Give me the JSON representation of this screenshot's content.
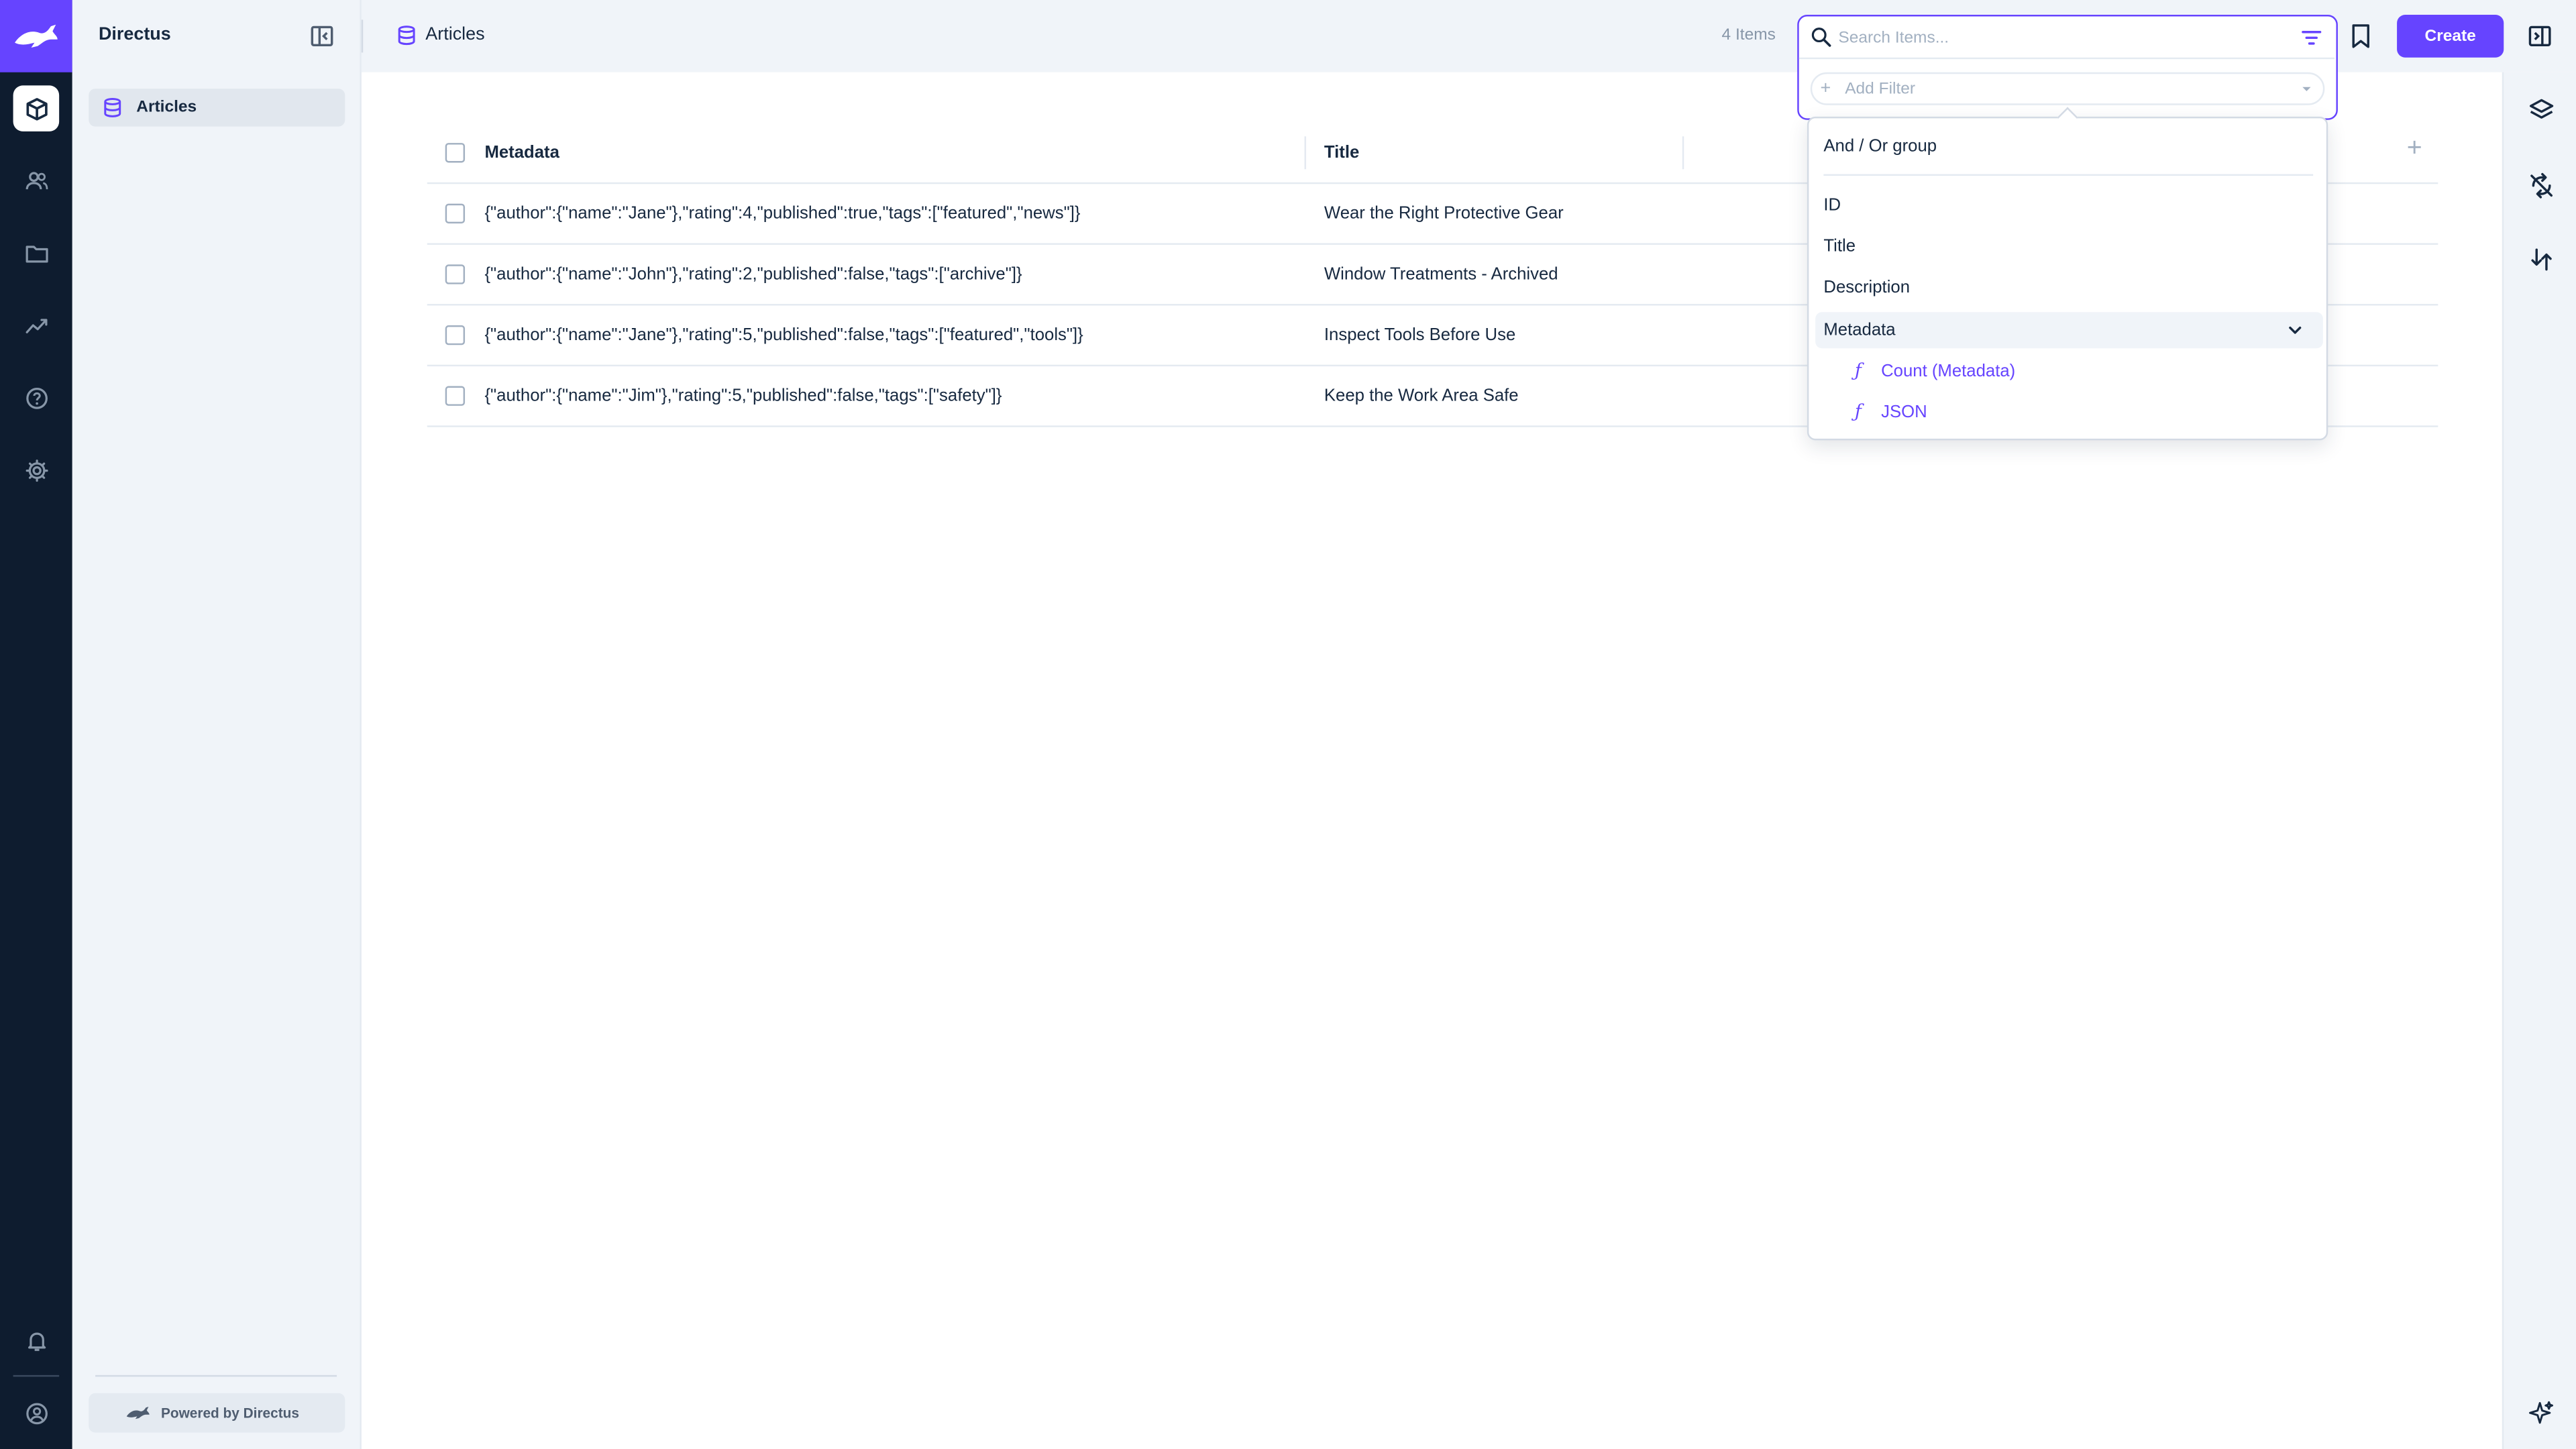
{
  "app": {
    "name": "Directus",
    "powered_by": "Powered by Directus"
  },
  "colors": {
    "accent": "#6644ff",
    "module_bar": "#0e1c2f",
    "nav_background": "#f0f4f9"
  },
  "module_bar": {
    "items": [
      {
        "icon": "content-box-icon",
        "active": true
      },
      {
        "icon": "users-icon",
        "active": false
      },
      {
        "icon": "files-folder-icon",
        "active": false
      },
      {
        "icon": "insights-chart-icon",
        "active": false
      },
      {
        "icon": "help-icon",
        "active": false
      },
      {
        "icon": "settings-gear-icon",
        "active": false
      }
    ],
    "bottom_items": [
      {
        "icon": "notifications-bell-icon"
      },
      {
        "icon": "user-account-icon"
      }
    ]
  },
  "navigation": {
    "collections": [
      {
        "label": "Articles",
        "icon": "database-icon",
        "active": true
      }
    ]
  },
  "header": {
    "title": "Articles",
    "item_count": "4 Items",
    "create_label": "Create"
  },
  "search": {
    "placeholder": "Search Items...",
    "value": "",
    "add_filter_label": "Add Filter"
  },
  "filter_dropdown": {
    "group_option": "And / Or group",
    "fields": [
      {
        "label": "ID"
      },
      {
        "label": "Title"
      },
      {
        "label": "Description"
      },
      {
        "label": "Metadata",
        "expanded": true
      }
    ],
    "metadata_functions": [
      {
        "label": "Count (Metadata)"
      },
      {
        "label": "JSON"
      }
    ]
  },
  "table": {
    "columns": [
      {
        "label": "Metadata"
      },
      {
        "label": "Title"
      }
    ],
    "rows": [
      {
        "metadata": "{\"author\":{\"name\":\"Jane\"},\"rating\":4,\"published\":true,\"tags\":[\"featured\",\"news\"]}",
        "title": "Wear the Right Protective Gear"
      },
      {
        "metadata": "{\"author\":{\"name\":\"John\"},\"rating\":2,\"published\":false,\"tags\":[\"archive\"]}",
        "title": "Window Treatments - Archived"
      },
      {
        "metadata": "{\"author\":{\"name\":\"Jane\"},\"rating\":5,\"published\":false,\"tags\":[\"featured\",\"tools\"]}",
        "title": "Inspect Tools Before Use"
      },
      {
        "metadata": "{\"author\":{\"name\":\"Jim\"},\"rating\":5,\"published\":false,\"tags\":[\"safety\"]}",
        "title": "Keep the Work Area Safe"
      }
    ]
  }
}
